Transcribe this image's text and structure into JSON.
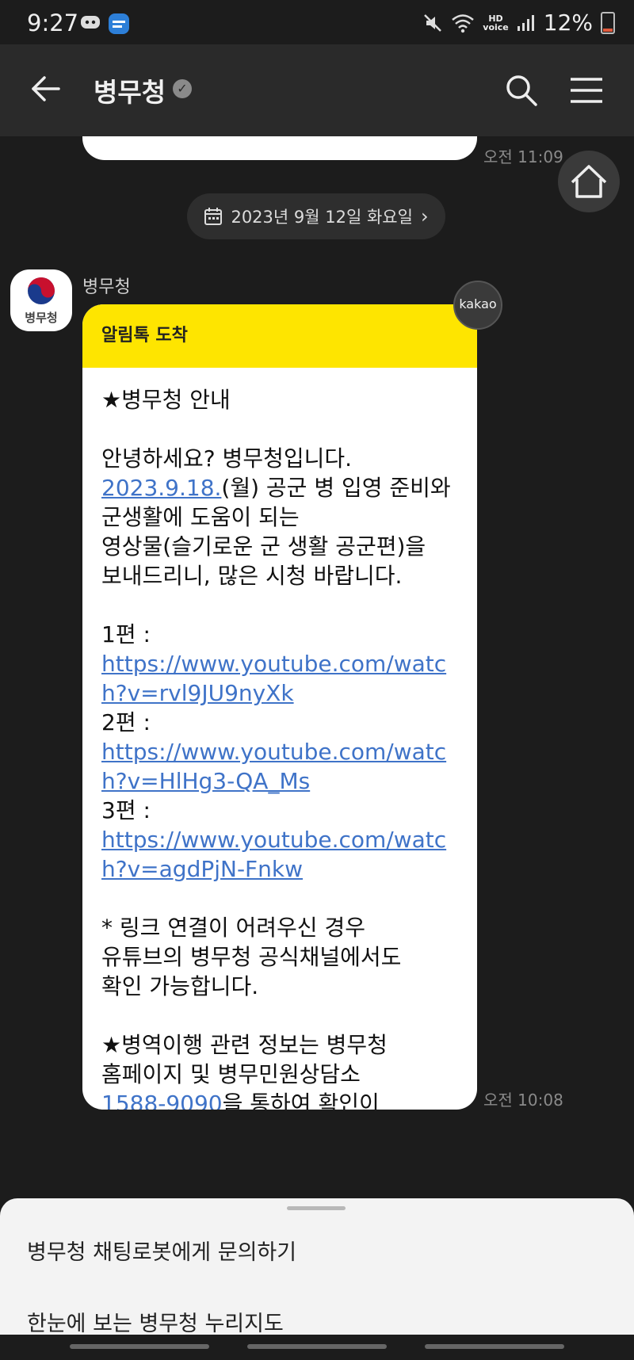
{
  "status_bar": {
    "time": "9:27",
    "battery": "12%",
    "hd_voice": "HD\nvoice",
    "icons": [
      "discord-icon",
      "app-badge-icon",
      "mute-icon",
      "wifi-icon",
      "signal-icon",
      "battery-icon"
    ]
  },
  "header": {
    "title": "병무청",
    "verified_icon": "verified-badge-icon",
    "back_icon": "back-arrow-icon",
    "search_icon": "search-icon",
    "menu_icon": "hamburger-menu-icon"
  },
  "chat": {
    "prev_message_time": "오전 11:09",
    "date_chip": "2023년 9월 12일 화요일",
    "sender": "병무청",
    "avatar_label": "병무청",
    "kakao_badge": "kakao",
    "message": {
      "header": "알림톡 도착",
      "line_title": "★병무청 안내",
      "greeting": "안녕하세요? 병무청입니다.",
      "date_link": "2023.9.18.",
      "intro_rest": "(월) 공군 병 입영 준비와\n군생활에 도움이 되는\n영상물(슬기로운 군 생활 공군편)을\n보내드리니, 많은 시청 바랍니다.",
      "ep1_label": "1편 :",
      "ep1_link": "https://www.youtube.com/watch?v=rvl9JU9nyXk",
      "ep2_label": "2편 :",
      "ep2_link": "https://www.youtube.com/watch?v=HlHg3-QA_Ms",
      "ep3_label": "3편 :",
      "ep3_link": "https://www.youtube.com/watch?v=agdPjN-Fnkw",
      "note": "* 링크 연결이 어려우신 경우\n유튜브의 병무청 공식채널에서도\n확인 가능합니다.",
      "info_pre": "★병역이행 관련 정보는 병무청\n홈페이지 및 병무민원상담소\n",
      "phone_link": "1588-9090",
      "info_post": "을 통하여 확인이\n가능합니다."
    },
    "message_time": "오전 10:08"
  },
  "bottom_sheet": {
    "items": [
      "병무청 채팅로봇에게 문의하기",
      "한눈에 보는 병무청 누리지도"
    ]
  },
  "colors": {
    "kakao_yellow": "#fee500",
    "link_blue": "#3f73c8",
    "background": "#1c1c1c"
  }
}
